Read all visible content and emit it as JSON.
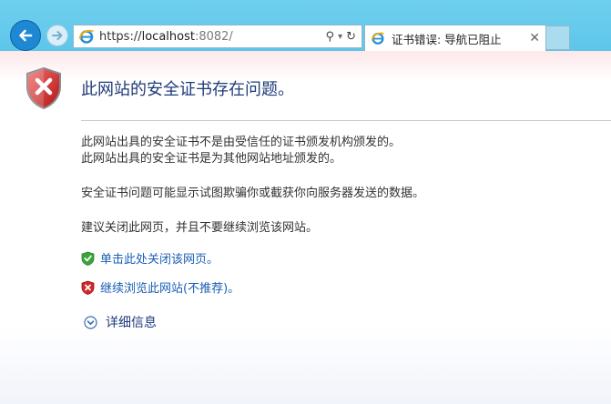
{
  "browser": {
    "url_prefix": "https://",
    "url_host": "localhost",
    "url_rest": ":8082/",
    "tab_title": "证书错误: 导航已阻止",
    "search_glyph": "⚲",
    "dropdown_glyph": "▾",
    "refresh_glyph": "↻",
    "close_glyph": "✕",
    "back_icon": "back-arrow-icon",
    "forward_icon": "forward-arrow-icon",
    "accent_color": "#5ec6ea"
  },
  "page": {
    "heading": "此网站的安全证书存在问题。",
    "line1": "此网站出具的安全证书不是由受信任的证书颁发机构颁发的。",
    "line2": "此网站出具的安全证书是为其他网站地址颁发的。",
    "line3": "安全证书问题可能显示试图欺骗你或截获你向服务器发送的数据。",
    "line4": "建议关闭此网页，并且不要继续浏览该网站。",
    "close_link": "单击此处关闭该网页。",
    "continue_link": "继续浏览此网站(不推荐)。",
    "details": "详细信息",
    "heading_color": "#1f3b7a",
    "link_color": "#1a5fb4"
  }
}
